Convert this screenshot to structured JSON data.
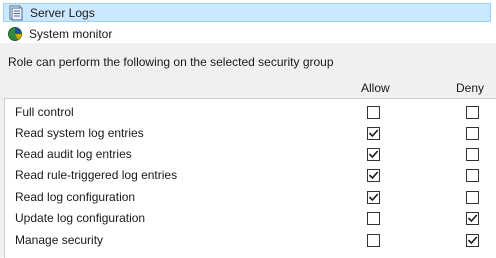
{
  "tree": {
    "items": [
      {
        "label": "Server Logs",
        "icon": "server-logs-icon",
        "selected": true
      },
      {
        "label": "System monitor",
        "icon": "system-monitor-icon",
        "selected": false
      }
    ]
  },
  "permissions": {
    "description": "Role can perform the following on the selected security group",
    "columns": {
      "allow": "Allow",
      "deny": "Deny"
    },
    "rows": [
      {
        "name": "Full control",
        "allow": false,
        "deny": false
      },
      {
        "name": "Read system log entries",
        "allow": true,
        "deny": false
      },
      {
        "name": "Read audit log entries",
        "allow": true,
        "deny": false
      },
      {
        "name": "Read rule-triggered log entries",
        "allow": true,
        "deny": false
      },
      {
        "name": "Read log configuration",
        "allow": true,
        "deny": false
      },
      {
        "name": "Update log configuration",
        "allow": false,
        "deny": true
      },
      {
        "name": "Manage security",
        "allow": false,
        "deny": true
      }
    ]
  },
  "colors": {
    "selection_fill": "#cce8ff",
    "selection_border": "#99d1ff",
    "panel_background": "#f0f0f0"
  }
}
